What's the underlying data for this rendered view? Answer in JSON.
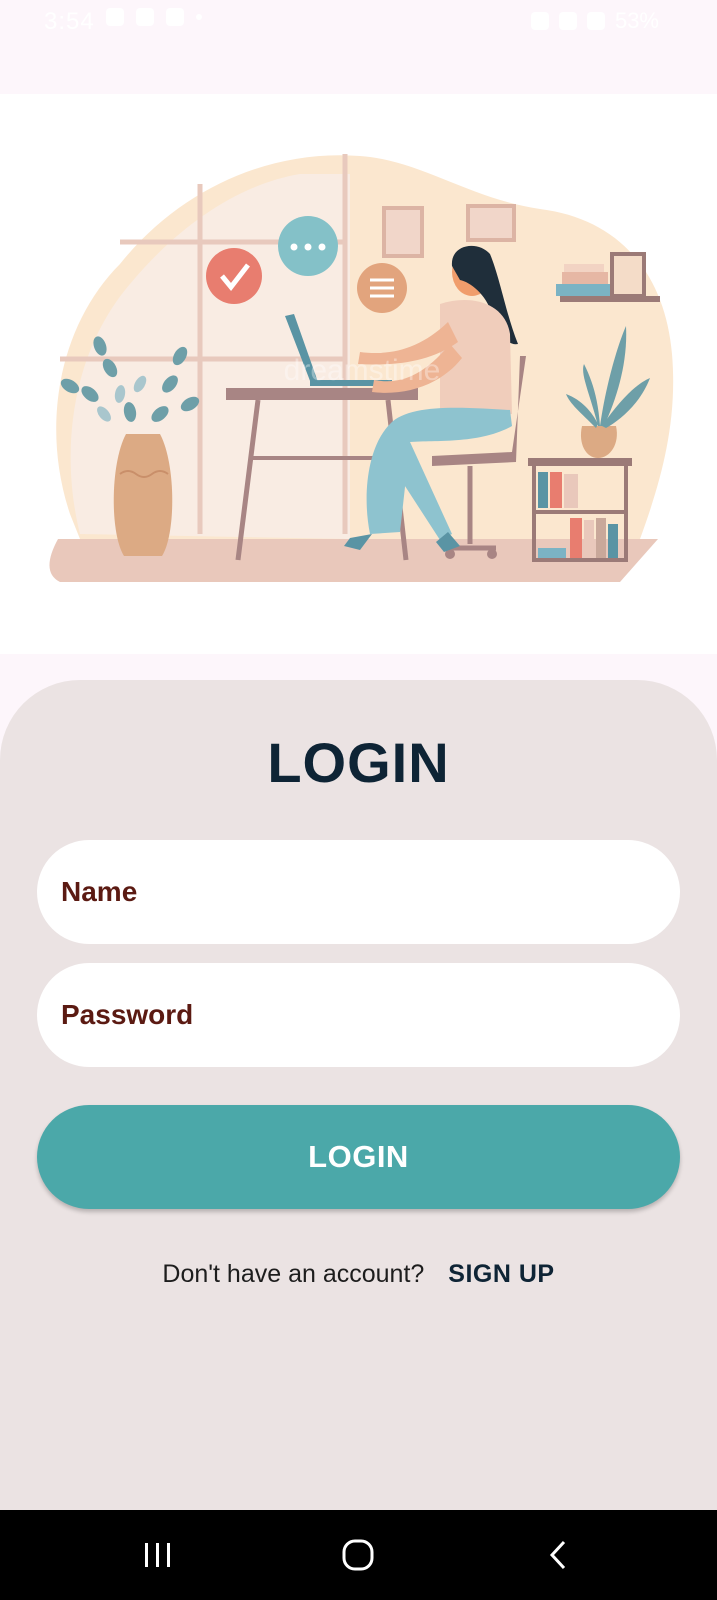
{
  "status_bar": {
    "time": "3:54",
    "battery": "53%"
  },
  "illustration": {
    "icon": "woman-working-at-laptop-illustration",
    "watermark": "dreamstime"
  },
  "login": {
    "title": "LOGIN",
    "name_placeholder": "Name",
    "password_placeholder": "Password",
    "button_label": "LOGIN",
    "signup_prompt": "Don't have an account?",
    "signup_link": "SIGN UP"
  },
  "nav_bar": {
    "recents_icon": "recents-icon",
    "home_icon": "home-icon",
    "back_icon": "back-icon"
  },
  "colors": {
    "background": "#fdf6fb",
    "card": "#ebe3e3",
    "title": "#0e2435",
    "field_text": "#5b1a12",
    "button": "#4ba8a9"
  }
}
